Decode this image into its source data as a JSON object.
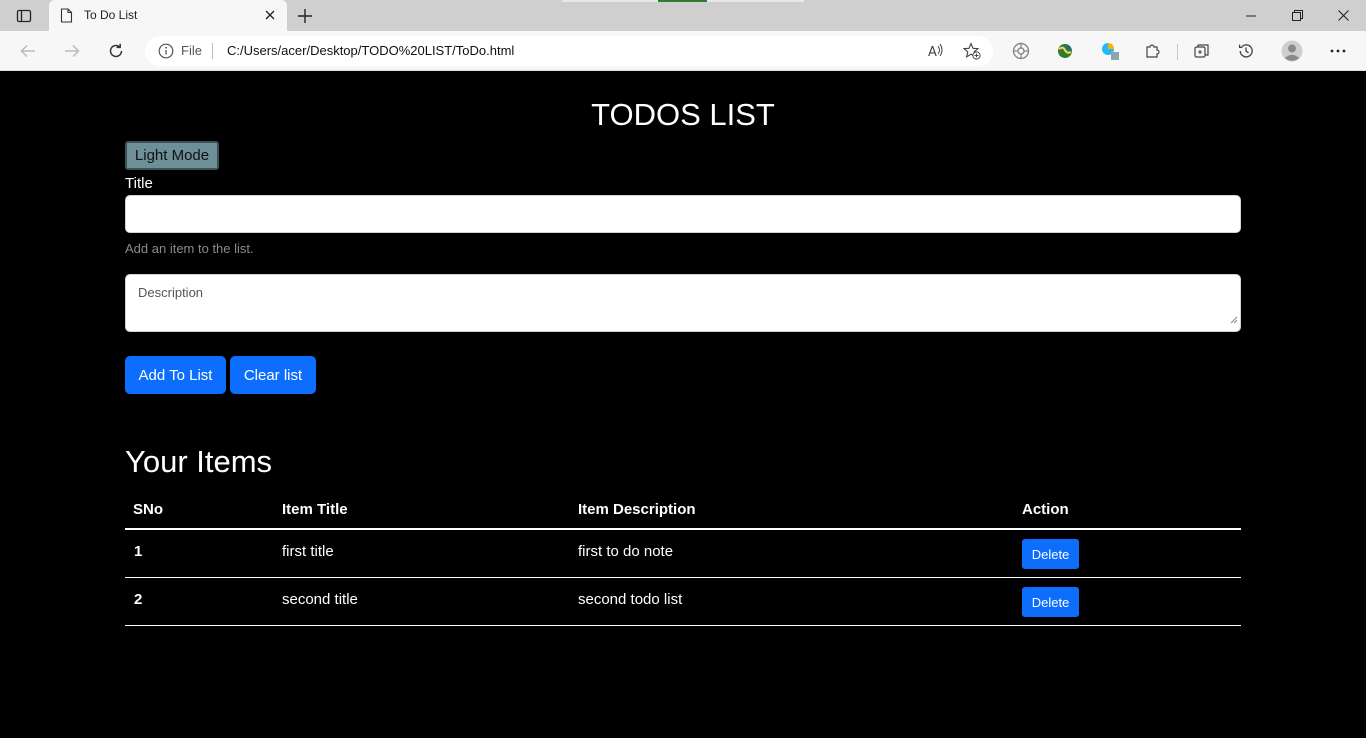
{
  "browser": {
    "tab_title": "To Do List",
    "address": {
      "file_label": "File",
      "url": "C:/Users/acer/Desktop/TODO%20LIST/ToDo.html"
    }
  },
  "app": {
    "heading": "TODOS LIST",
    "mode_button": "Light Mode",
    "title_label": "Title",
    "title_value": "",
    "helper_text": "Add an item to the list.",
    "description_placeholder": "Description",
    "add_button": "Add To List",
    "clear_button": "Clear list",
    "items_heading": "Your Items",
    "table": {
      "headers": [
        "SNo",
        "Item Title",
        "Item Description",
        "Action"
      ],
      "rows": [
        {
          "sno": "1",
          "title": "first title",
          "description": "first to do note",
          "action": "Delete"
        },
        {
          "sno": "2",
          "title": "second title",
          "description": "second todo list",
          "action": "Delete"
        }
      ]
    }
  },
  "colors": {
    "page_background": "#000000",
    "primary_button": "#0d6efd",
    "mode_button": "#6c8f98"
  }
}
